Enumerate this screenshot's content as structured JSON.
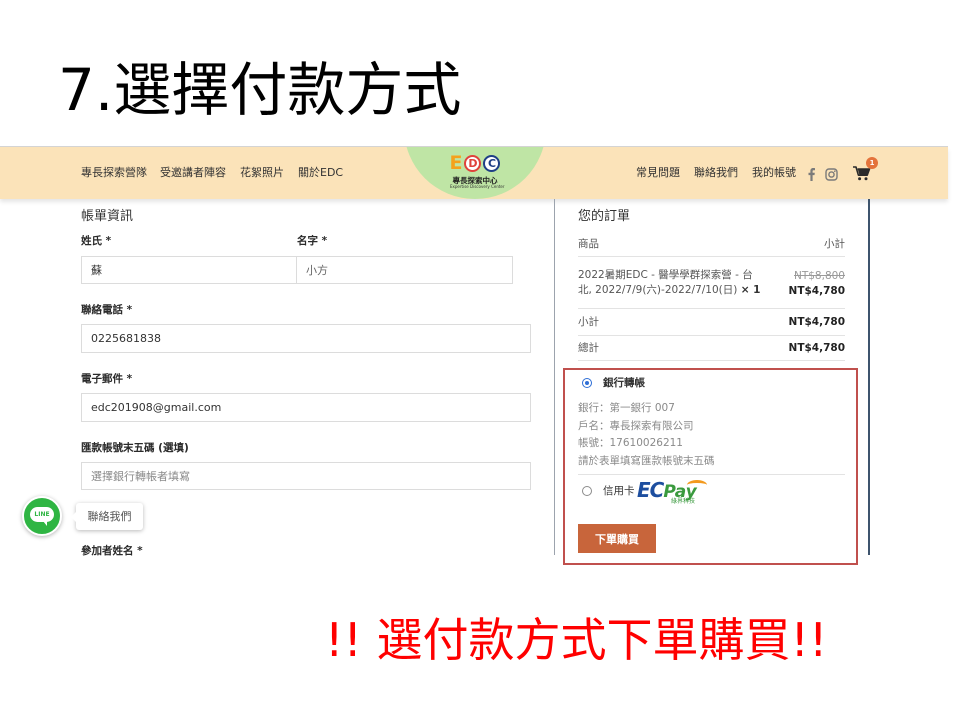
{
  "slide": {
    "title": "7.選擇付款方式",
    "callout": "!! 選付款方式下單購買!!",
    "callout_color": "#ff0000"
  },
  "header": {
    "background": "#fbe3b9",
    "nav_left": [
      {
        "label": "專長探索營隊"
      },
      {
        "label": "受邀講者陣容"
      },
      {
        "label": "花絮照片"
      },
      {
        "label": "關於EDC"
      }
    ],
    "logo": {
      "letter_e": "E",
      "letter_d": "D",
      "letter_c": "C",
      "name_zh": "專長探索中心",
      "name_en": "Expertise Discovery Center"
    },
    "nav_right": [
      {
        "label": "常見問題"
      },
      {
        "label": "聯絡我們"
      },
      {
        "label": "我的帳號"
      }
    ],
    "social_icons": [
      "facebook-icon",
      "instagram-icon"
    ],
    "cart": {
      "icon": "cart-icon",
      "count": "1"
    }
  },
  "billing": {
    "heading": "帳單資訊",
    "fields": {
      "last_name": {
        "label": "姓氏",
        "required": "*",
        "value": "蘇"
      },
      "first_name": {
        "label": "名字",
        "required": "*",
        "value": "小方"
      },
      "phone": {
        "label": "聯絡電話",
        "required": "*",
        "value": "0225681838"
      },
      "email": {
        "label": "電子郵件",
        "required": "*",
        "value": "edc201908@gmail.com"
      },
      "account_last5": {
        "label": "匯款帳號末五碼 (選填)",
        "placeholder": "選擇銀行轉帳者填寫"
      },
      "participant_name": {
        "label": "參加者姓名",
        "required": "*"
      }
    }
  },
  "order": {
    "heading": "您的訂單",
    "col_product": "商品",
    "col_subtotal": "小計",
    "items": [
      {
        "name": "2022暑期EDC - 醫學學群探索營 - 台北, 2022/7/9(六)-2022/7/10(日)",
        "qty": "× 1",
        "original_price": "NT$8,800",
        "price": "NT$4,780"
      }
    ],
    "subtotal_label": "小計",
    "subtotal": "NT$4,780",
    "total_label": "總計",
    "total": "NT$4,780"
  },
  "payment": {
    "highlight_color": "#c0504d",
    "methods": [
      {
        "label": "銀行轉帳",
        "selected": true,
        "details": [
          "銀行：第一銀行 007",
          "戶名：專長探索有限公司",
          "帳號：17610026211",
          "請於表單填寫匯款帳號末五碼"
        ]
      },
      {
        "label": "信用卡",
        "selected": false,
        "logo": {
          "part1": "EC",
          "part2": "Pay",
          "sub": "綠界科技"
        }
      }
    ],
    "place_order": "下單購買",
    "button_color": "#c8653b"
  },
  "line_widget": {
    "icon": "line-icon",
    "icon_text": "LINE",
    "tooltip": "聯絡我們"
  }
}
